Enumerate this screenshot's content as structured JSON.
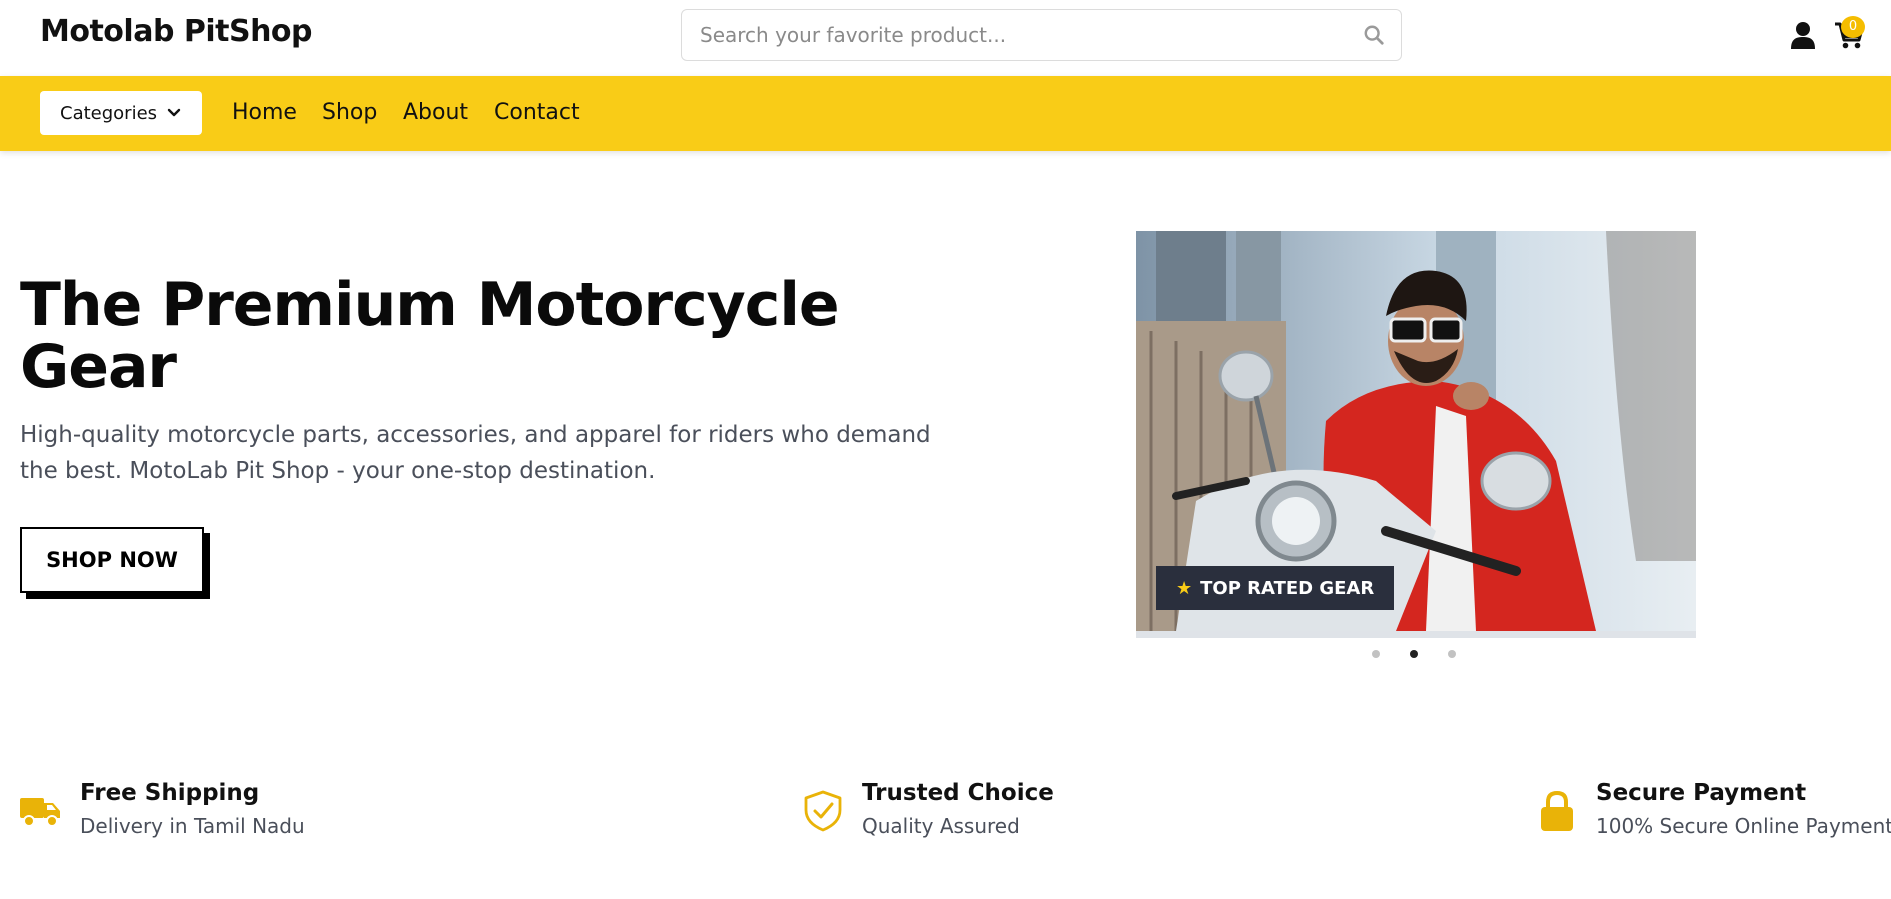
{
  "header": {
    "logo": "Motolab PitShop",
    "search_placeholder": "Search your favorite product...",
    "cart_count": "0",
    "icons": {
      "search": "search-icon",
      "user": "user-icon",
      "cart": "cart-icon"
    }
  },
  "nav": {
    "categories_label": "Categories",
    "links": [
      "Home",
      "Shop",
      "About",
      "Contact"
    ]
  },
  "hero": {
    "title": "The Premium Motorcycle Gear",
    "description": "High-quality motorcycle parts, accessories, and apparel for riders who demand the best. MotoLab Pit Shop - your one-stop destination.",
    "cta": "SHOP NOW",
    "slide_badge": "TOP RATED GEAR",
    "slides_total": 3,
    "active_slide": 2
  },
  "features": [
    {
      "title": "Free Shipping",
      "subtitle": "Delivery in Tamil Nadu",
      "icon": "truck-icon"
    },
    {
      "title": "Trusted Choice",
      "subtitle": "Quality Assured",
      "icon": "shield-check-icon"
    },
    {
      "title": "Secure Payment",
      "subtitle": "100% Secure Online Payment",
      "icon": "lock-icon"
    }
  ],
  "colors": {
    "accent": "#f9cc17",
    "icon_accent": "#e9b308",
    "badge_bg": "#2a2f3d"
  }
}
